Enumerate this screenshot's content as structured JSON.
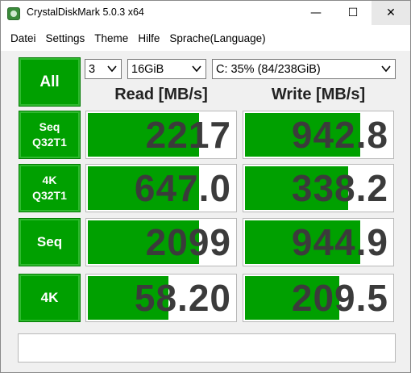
{
  "window": {
    "title": "CrystalDiskMark 5.0.3 x64",
    "minimize": "—",
    "maximize": "☐",
    "close": "✕"
  },
  "menu": [
    "Datei",
    "Settings",
    "Theme",
    "Hilfe",
    "Sprache(Language)"
  ],
  "controls": {
    "all_label": "All",
    "count": "3",
    "size": "16GiB",
    "drive": "C: 35% (84/238GiB)"
  },
  "headers": {
    "read": "Read [MB/s]",
    "write": "Write [MB/s]"
  },
  "colors": {
    "accent": "#00a000",
    "value_text": "#3b3b3b"
  },
  "rows": [
    {
      "label_line1": "Seq",
      "label_line2": "Q32T1",
      "read": "2217",
      "write": "942.8",
      "read_fill": 0.74,
      "write_fill": 0.77
    },
    {
      "label_line1": "4K",
      "label_line2": "Q32T1",
      "read": "647.0",
      "write": "338.2",
      "read_fill": 0.74,
      "write_fill": 0.69
    },
    {
      "label_line1": "Seq",
      "label_line2": "",
      "read": "2099",
      "write": "944.9",
      "read_fill": 0.74,
      "write_fill": 0.77
    },
    {
      "label_line1": "4K",
      "label_line2": "",
      "read": "58.20",
      "write": "209.5",
      "read_fill": 0.54,
      "write_fill": 0.63
    }
  ],
  "comment": ""
}
